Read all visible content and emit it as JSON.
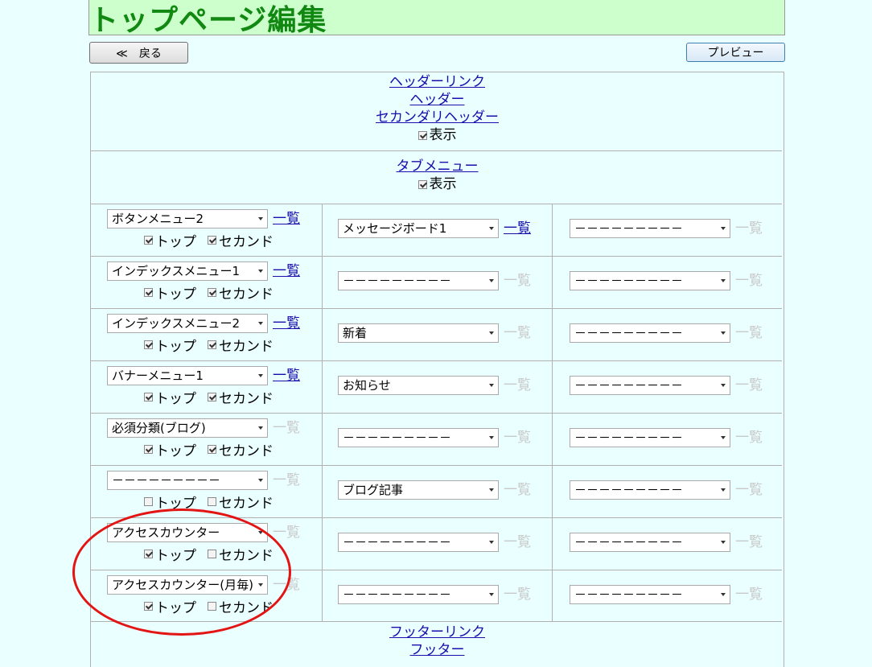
{
  "page": {
    "title": "トップページ編集"
  },
  "toolbar": {
    "back_label": "≪　戻る",
    "preview_label": "プレビュー"
  },
  "header_section": {
    "links": [
      "ヘッダーリンク",
      "ヘッダー",
      "セカンダリヘッダー"
    ],
    "show_label": "表示",
    "show_checked": true
  },
  "tab_section": {
    "link": "タブメニュー",
    "show_label": "表示",
    "show_checked": true
  },
  "list_link_label": "一覧",
  "option_labels": {
    "top": "トップ",
    "second": "セカンド"
  },
  "rows": [
    {
      "col1": {
        "value": "ボタンメニュー2",
        "list_active": true,
        "top": true,
        "second": true
      },
      "col2": {
        "value": "メッセージボード1",
        "list_active": true
      },
      "col3": {
        "value": "－－－－－－－－－",
        "list_active": false
      }
    },
    {
      "col1": {
        "value": "インデックスメニュー1",
        "list_active": true,
        "top": true,
        "second": true
      },
      "col2": {
        "value": "－－－－－－－－－",
        "list_active": false
      },
      "col3": {
        "value": "－－－－－－－－－",
        "list_active": false
      }
    },
    {
      "col1": {
        "value": "インデックスメニュー2",
        "list_active": true,
        "top": true,
        "second": true
      },
      "col2": {
        "value": "新着",
        "list_active": false
      },
      "col3": {
        "value": "－－－－－－－－－",
        "list_active": false
      }
    },
    {
      "col1": {
        "value": "バナーメニュー1",
        "list_active": true,
        "top": true,
        "second": true
      },
      "col2": {
        "value": "お知らせ",
        "list_active": false
      },
      "col3": {
        "value": "－－－－－－－－－",
        "list_active": false
      }
    },
    {
      "col1": {
        "value": "必須分類(ブログ)",
        "list_active": false,
        "top": true,
        "second": true
      },
      "col2": {
        "value": "－－－－－－－－－",
        "list_active": false
      },
      "col3": {
        "value": "－－－－－－－－－",
        "list_active": false
      }
    },
    {
      "col1": {
        "value": "－－－－－－－－－",
        "list_active": false,
        "top": false,
        "second": false
      },
      "col2": {
        "value": "ブログ記事",
        "list_active": false
      },
      "col3": {
        "value": "－－－－－－－－－",
        "list_active": false
      }
    },
    {
      "col1": {
        "value": "アクセスカウンター",
        "list_active": false,
        "top": true,
        "second": false
      },
      "col2": {
        "value": "－－－－－－－－－",
        "list_active": false
      },
      "col3": {
        "value": "－－－－－－－－－",
        "list_active": false
      }
    },
    {
      "col1": {
        "value": "アクセスカウンター(月毎)",
        "list_active": false,
        "top": true,
        "second": false
      },
      "col2": {
        "value": "－－－－－－－－－",
        "list_active": false
      },
      "col3": {
        "value": "－－－－－－－－－",
        "list_active": false
      }
    }
  ],
  "footer_section": {
    "links": [
      "フッターリンク",
      "フッター"
    ]
  },
  "annotation": {
    "color": "#e31414"
  }
}
